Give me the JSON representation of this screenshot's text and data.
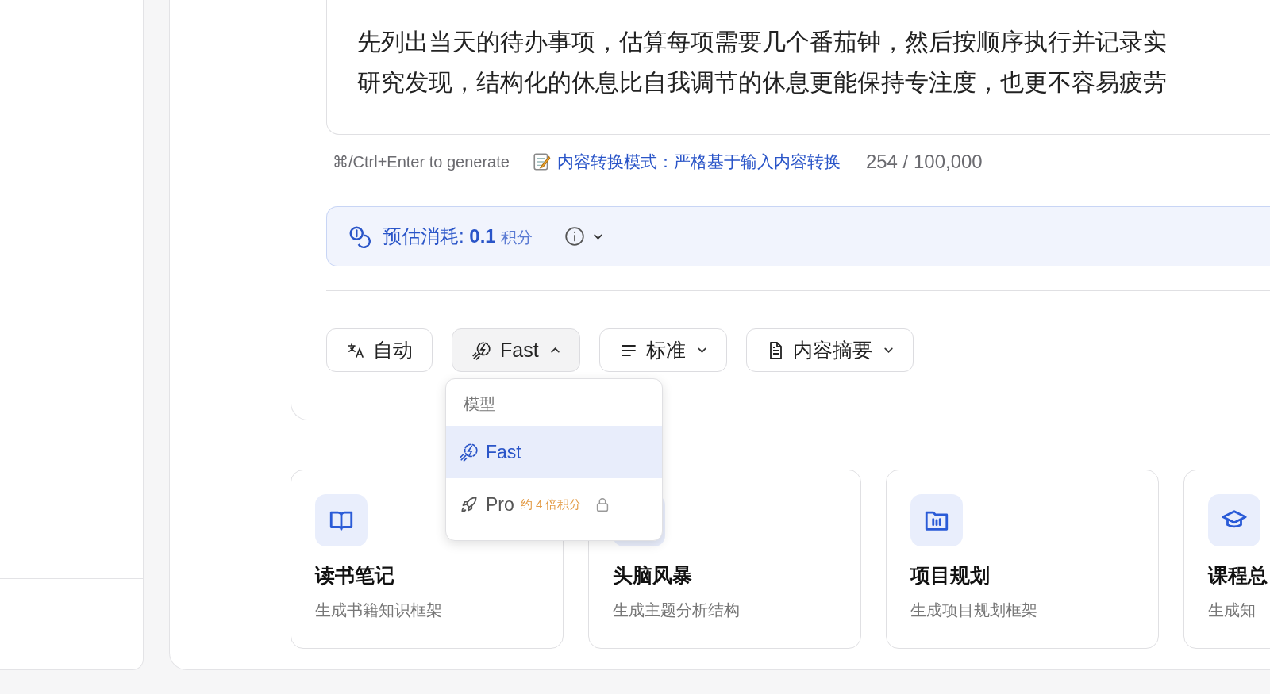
{
  "editor": {
    "lines": [
      "先列出当天的待办事项，估算每项需要几个番茄钟，然后按顺序执行并记录实",
      "研究发现，结构化的休息比自我调节的休息更能保持专注度，也更不容易疲劳"
    ]
  },
  "hint": "⌘/Ctrl+Enter to generate",
  "mode_notice": "内容转换模式：严格基于输入内容转换",
  "char_count": "254 / 100,000",
  "cost": {
    "label": "预估消耗:",
    "value": "0.1",
    "unit": "积分",
    "expanded": false
  },
  "toolbar": [
    {
      "kind": "language",
      "label": "自动"
    },
    {
      "kind": "model",
      "label": "Fast",
      "expanded": true
    },
    {
      "kind": "length",
      "label": "标准",
      "expanded": false
    },
    {
      "kind": "template",
      "label": "内容摘要",
      "expanded": false
    }
  ],
  "model_menu": {
    "heading": "模型",
    "items": [
      {
        "kind": "fast",
        "label": "Fast",
        "selected": true,
        "locked": false
      },
      {
        "kind": "pro",
        "label": "Pro",
        "note": "约 4 倍积分",
        "selected": false,
        "locked": true
      }
    ]
  },
  "templates": [
    {
      "kind": "book",
      "title": "读书笔记",
      "desc": "生成书籍知识框架"
    },
    {
      "title": "头脑风暴",
      "desc": "生成主题分析结构"
    },
    {
      "kind": "folder",
      "title": "项目规划",
      "desc": "生成项目规划框架"
    },
    {
      "kind": "cap",
      "title": "课程总",
      "desc": "生成知"
    }
  ]
}
